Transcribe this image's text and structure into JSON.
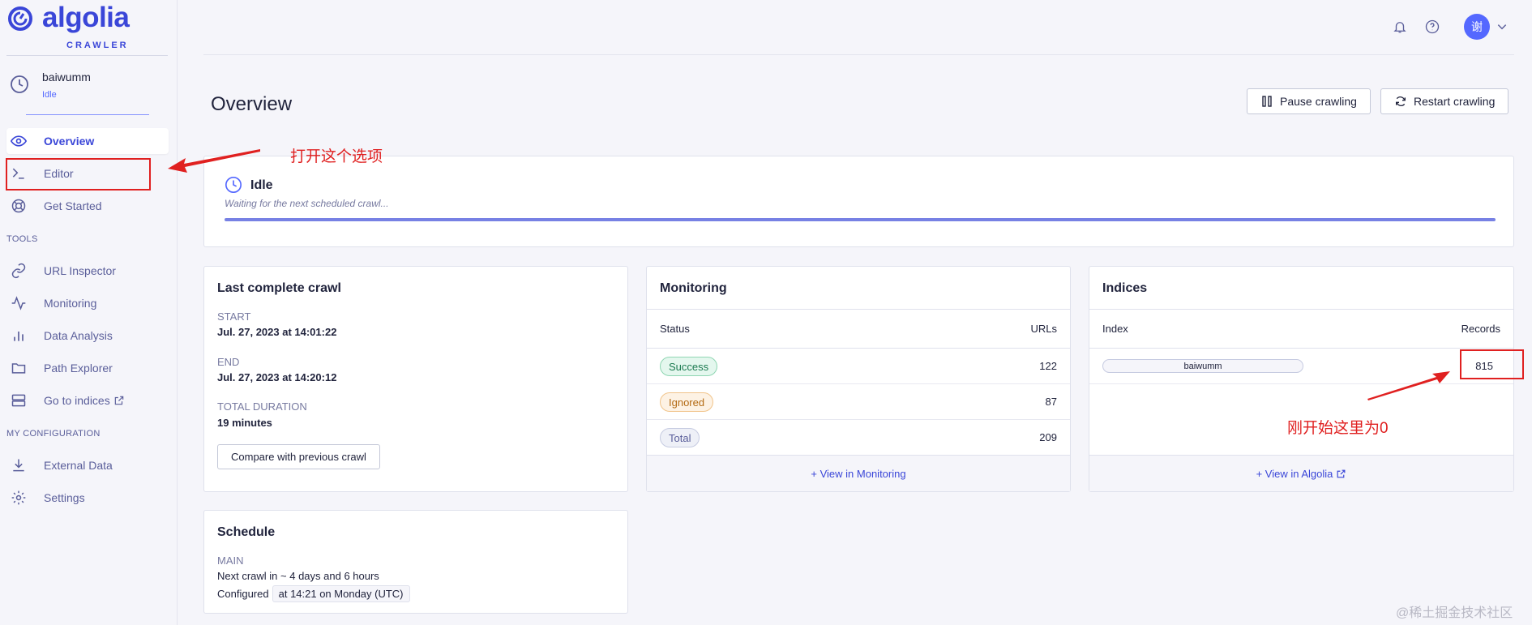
{
  "brand": {
    "name": "algolia",
    "product": "CRAWLER",
    "color": "#3a46d8"
  },
  "crawler": {
    "name": "baiwumm",
    "state": "Idle"
  },
  "nav": {
    "items": [
      {
        "label": "Overview",
        "icon": "eye-icon",
        "active": true
      },
      {
        "label": "Editor",
        "icon": "terminal-icon"
      },
      {
        "label": "Get Started",
        "icon": "lifebuoy-icon"
      }
    ],
    "tools_header": "TOOLS",
    "tools": [
      {
        "label": "URL Inspector",
        "icon": "link-icon"
      },
      {
        "label": "Monitoring",
        "icon": "activity-icon"
      },
      {
        "label": "Data Analysis",
        "icon": "bar-chart-icon"
      },
      {
        "label": "Path Explorer",
        "icon": "folder-icon"
      },
      {
        "label": "Go to indices",
        "icon": "server-icon"
      }
    ],
    "config_header": "MY CONFIGURATION",
    "config": [
      {
        "label": "External Data",
        "icon": "download-icon"
      },
      {
        "label": "Settings",
        "icon": "gear-icon"
      }
    ]
  },
  "header": {
    "title": "Overview",
    "pause_label": "Pause crawling",
    "restart_label": "Restart crawling",
    "avatar_text": "谢"
  },
  "status": {
    "title": "Idle",
    "subtitle": "Waiting for the next scheduled crawl..."
  },
  "last_crawl": {
    "title": "Last complete crawl",
    "start_label": "START",
    "start_value": "Jul. 27, 2023 at 14:01:22",
    "end_label": "END",
    "end_value": "Jul. 27, 2023 at 14:20:12",
    "duration_label": "TOTAL DURATION",
    "duration_value": "19 minutes",
    "compare_label": "Compare with previous crawl"
  },
  "schedule": {
    "title": "Schedule",
    "main_label": "MAIN",
    "next_crawl": "Next crawl in ~ 4 days and 6 hours",
    "configured_label": "Configured",
    "configured_value": "at 14:21 on Monday (UTC)"
  },
  "monitoring": {
    "title": "Monitoring",
    "col_status": "Status",
    "col_urls": "URLs",
    "rows": [
      {
        "status": "Success",
        "urls": "122"
      },
      {
        "status": "Ignored",
        "urls": "87"
      },
      {
        "status": "Total",
        "urls": "209"
      }
    ],
    "footer": "+ View in Monitoring"
  },
  "indices": {
    "title": "Indices",
    "col_index": "Index",
    "col_records": "Records",
    "rows": [
      {
        "index": "baiwumm",
        "records": "815"
      }
    ],
    "footer": "+ View in Algolia"
  },
  "annotations": {
    "editor_note": "打开这个选项",
    "records_note": "刚开始这里为0",
    "color": "#e02020"
  },
  "watermark": "@稀土掘金技术社区"
}
